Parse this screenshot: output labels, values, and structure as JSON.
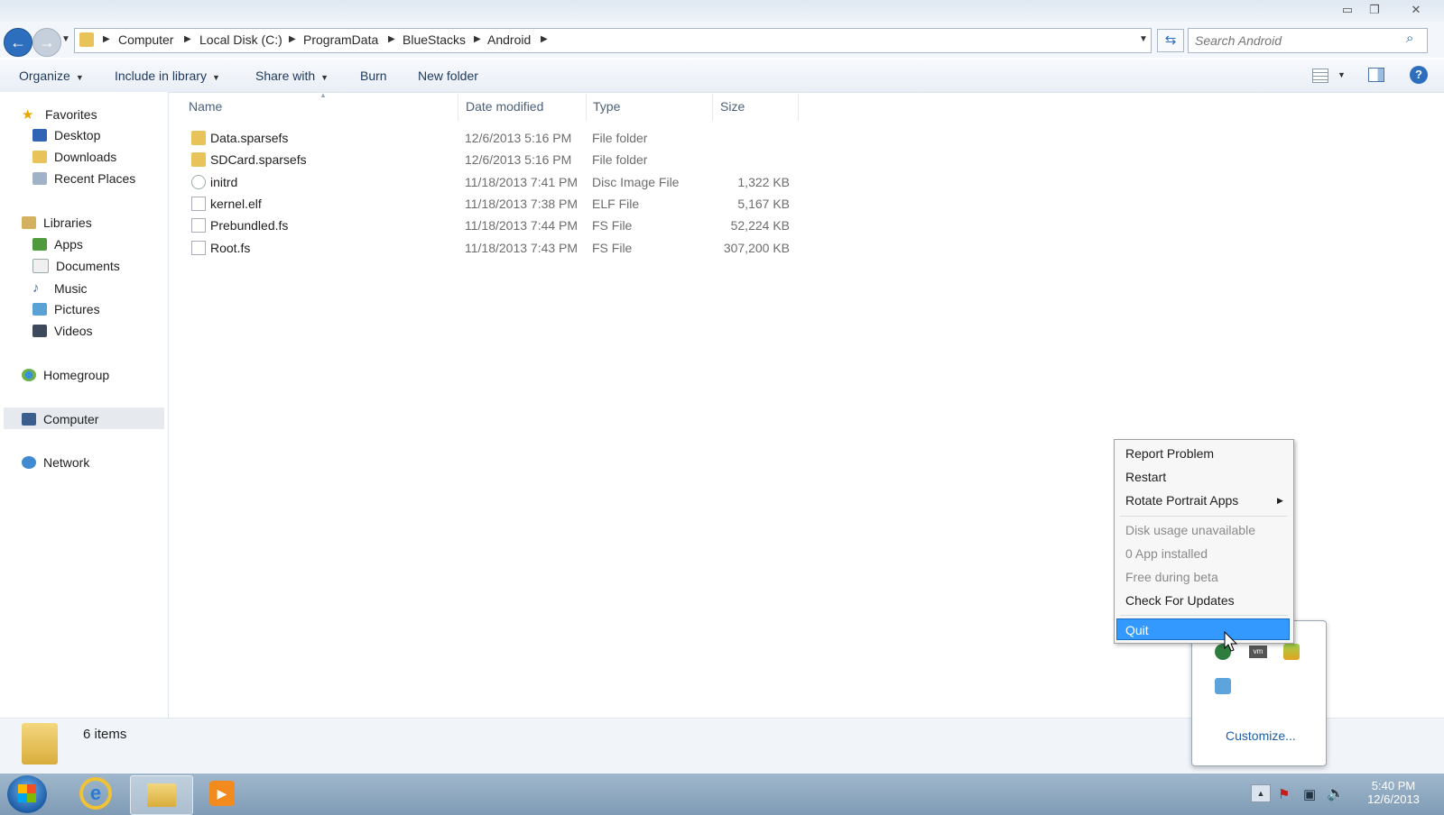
{
  "window": {
    "minimize_icon": "minimize-icon",
    "maximize_icon": "maximize-icon",
    "close_icon": "close-icon"
  },
  "address": {
    "crumbs": [
      "Computer",
      "Local Disk (C:)",
      "ProgramData",
      "BlueStacks",
      "Android"
    ],
    "search_placeholder": "Search Android"
  },
  "toolbar": {
    "organize": "Organize",
    "include_in_library": "Include in library",
    "share_with": "Share with",
    "burn": "Burn",
    "new_folder": "New folder"
  },
  "nav": {
    "favorites": "Favorites",
    "desktop": "Desktop",
    "downloads": "Downloads",
    "recent_places": "Recent Places",
    "libraries": "Libraries",
    "apps": "Apps",
    "documents": "Documents",
    "music": "Music",
    "pictures": "Pictures",
    "videos": "Videos",
    "homegroup": "Homegroup",
    "computer": "Computer",
    "network": "Network"
  },
  "columns": {
    "name": "Name",
    "date_modified": "Date modified",
    "type": "Type",
    "size": "Size"
  },
  "files": [
    {
      "name": "Data.sparsefs",
      "date": "12/6/2013 5:16 PM",
      "type": "File folder",
      "size": "",
      "icon": "folder-icon"
    },
    {
      "name": "SDCard.sparsefs",
      "date": "12/6/2013 5:16 PM",
      "type": "File folder",
      "size": "",
      "icon": "folder-icon"
    },
    {
      "name": "initrd",
      "date": "11/18/2013 7:41 PM",
      "type": "Disc Image File",
      "size": "1,322 KB",
      "icon": "disc-image-icon"
    },
    {
      "name": "kernel.elf",
      "date": "11/18/2013 7:38 PM",
      "type": "ELF File",
      "size": "5,167 KB",
      "icon": "file-icon"
    },
    {
      "name": "Prebundled.fs",
      "date": "11/18/2013 7:44 PM",
      "type": "FS File",
      "size": "52,224 KB",
      "icon": "file-icon"
    },
    {
      "name": "Root.fs",
      "date": "11/18/2013 7:43 PM",
      "type": "FS File",
      "size": "307,200 KB",
      "icon": "file-icon"
    }
  ],
  "status": {
    "items": "6 items"
  },
  "context_menu": {
    "report_problem": "Report Problem",
    "restart": "Restart",
    "rotate_portrait_apps": "Rotate Portrait Apps",
    "disk_usage": "Disk usage unavailable",
    "apps_installed": "0 App installed",
    "free_beta": "Free during beta",
    "check_updates": "Check For Updates",
    "quit": "Quit"
  },
  "tray": {
    "customize": "Customize...",
    "time": "5:40 PM",
    "date": "12/6/2013"
  },
  "colors": {
    "accent": "#3399ff",
    "link": "#1e5ea8",
    "hover": "#cde8ff"
  }
}
